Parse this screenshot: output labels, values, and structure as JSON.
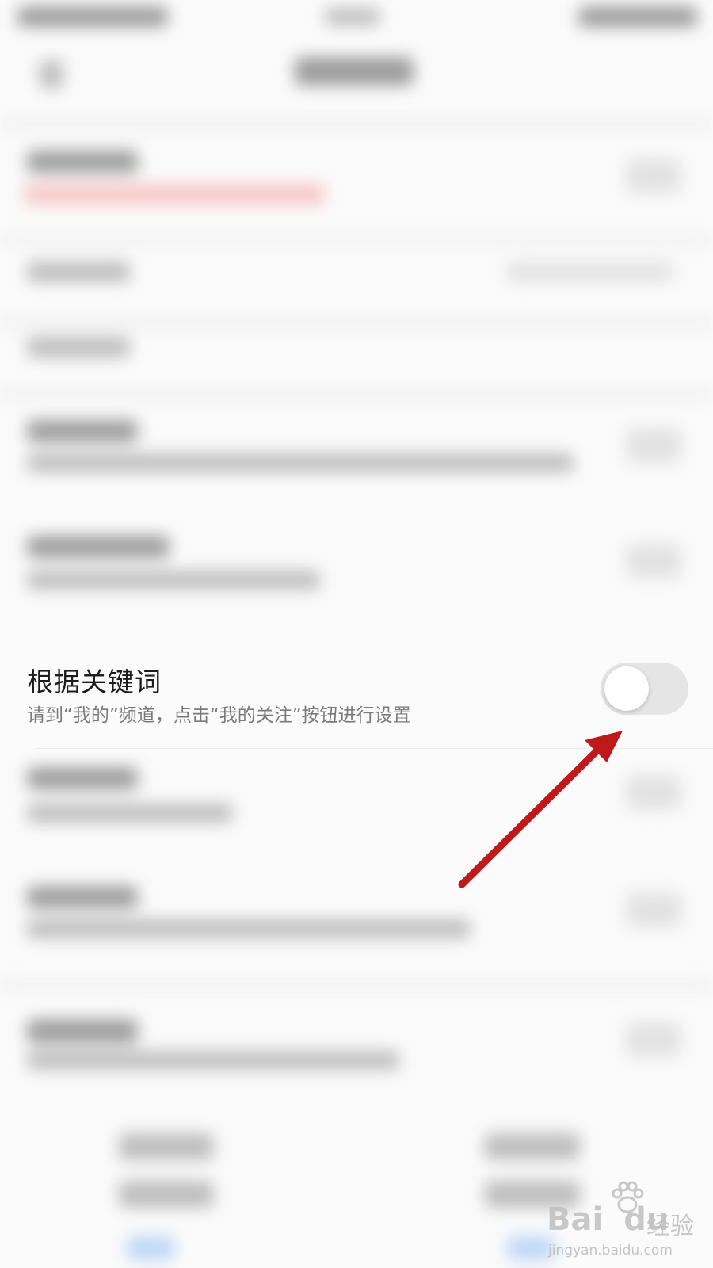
{
  "setting_row": {
    "title": "根据关键词",
    "description": "请到“我的”频道，点击“我的关注”按钮进行设置",
    "toggle_on": false
  },
  "watermark": {
    "brand": "Bai",
    "brand_suffix": "du",
    "label": "经验",
    "url": "jingyan.baidu.com"
  },
  "colors": {
    "arrow": "#c0191b",
    "toggle_track_off": "#e5e5e5",
    "title_text": "#1c1c1c",
    "desc_text": "#7a7a7a"
  }
}
